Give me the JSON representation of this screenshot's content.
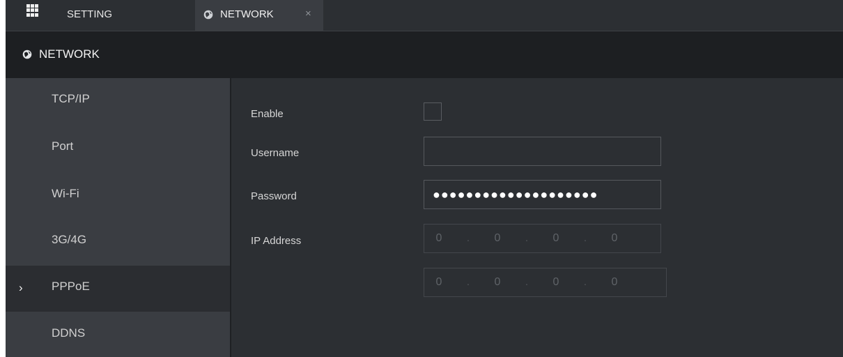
{
  "tabs": {
    "home_label": "SETTING",
    "active_label": "NETWORK",
    "close_glyph": "×"
  },
  "header": {
    "title": "NETWORK"
  },
  "sidebar": {
    "items": [
      {
        "label": "TCP/IP"
      },
      {
        "label": "Port"
      },
      {
        "label": "Wi-Fi"
      },
      {
        "label": "3G/4G"
      },
      {
        "label": "PPPoE",
        "active": true
      },
      {
        "label": "DDNS"
      }
    ],
    "active_marker": "›"
  },
  "form": {
    "enable_label": "Enable",
    "enable_checked": false,
    "username_label": "Username",
    "username_value": "",
    "password_label": "Password",
    "password_mask": "●●●●●●●●●●●●●●●●●●●●",
    "ip_label": "IP Address",
    "ip_address": [
      "0",
      "0",
      "0",
      "0"
    ],
    "ip_address_2": [
      "0",
      "0",
      "0",
      "0"
    ],
    "ip_separator": "."
  },
  "colors": {
    "background": "#2c2f33",
    "header": "#1d1f22",
    "sidebar": "#3a3d42",
    "active_item": "#2b2d31"
  },
  "icons": [
    "grid-icon",
    "globe-icon",
    "close-icon",
    "chevron-right-icon"
  ]
}
